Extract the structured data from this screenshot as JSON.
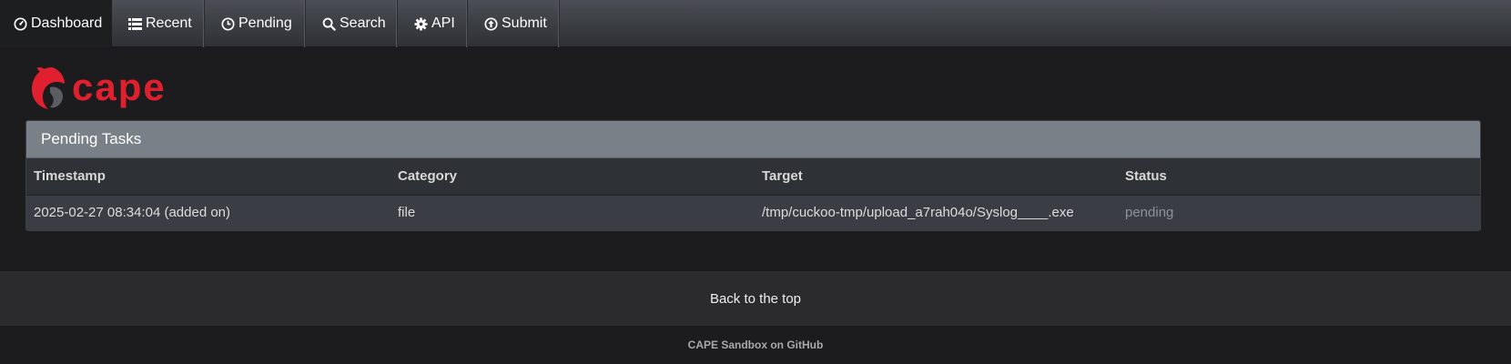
{
  "nav": {
    "items": [
      {
        "label": "Dashboard",
        "icon": "dashboard-icon",
        "active": true
      },
      {
        "label": "Recent",
        "icon": "list-icon"
      },
      {
        "label": "Pending",
        "icon": "clock-icon"
      },
      {
        "label": "Search",
        "icon": "search-icon"
      },
      {
        "label": "API",
        "icon": "gear-icon"
      },
      {
        "label": "Submit",
        "icon": "upload-circle-icon"
      }
    ]
  },
  "logo": {
    "text": "cape",
    "color": "#e0202e"
  },
  "panel": {
    "title": "Pending Tasks",
    "columns": [
      "Timestamp",
      "Category",
      "Target",
      "Status"
    ],
    "rows": [
      {
        "timestamp": "2025-02-27 08:34:04 (added on)",
        "category": "file",
        "target": "/tmp/cuckoo-tmp/upload_a7rah04o/Syslog____.exe",
        "status": "pending"
      }
    ]
  },
  "footer": {
    "back_to_top": "Back to the top",
    "github_link": "CAPE Sandbox on GitHub"
  }
}
